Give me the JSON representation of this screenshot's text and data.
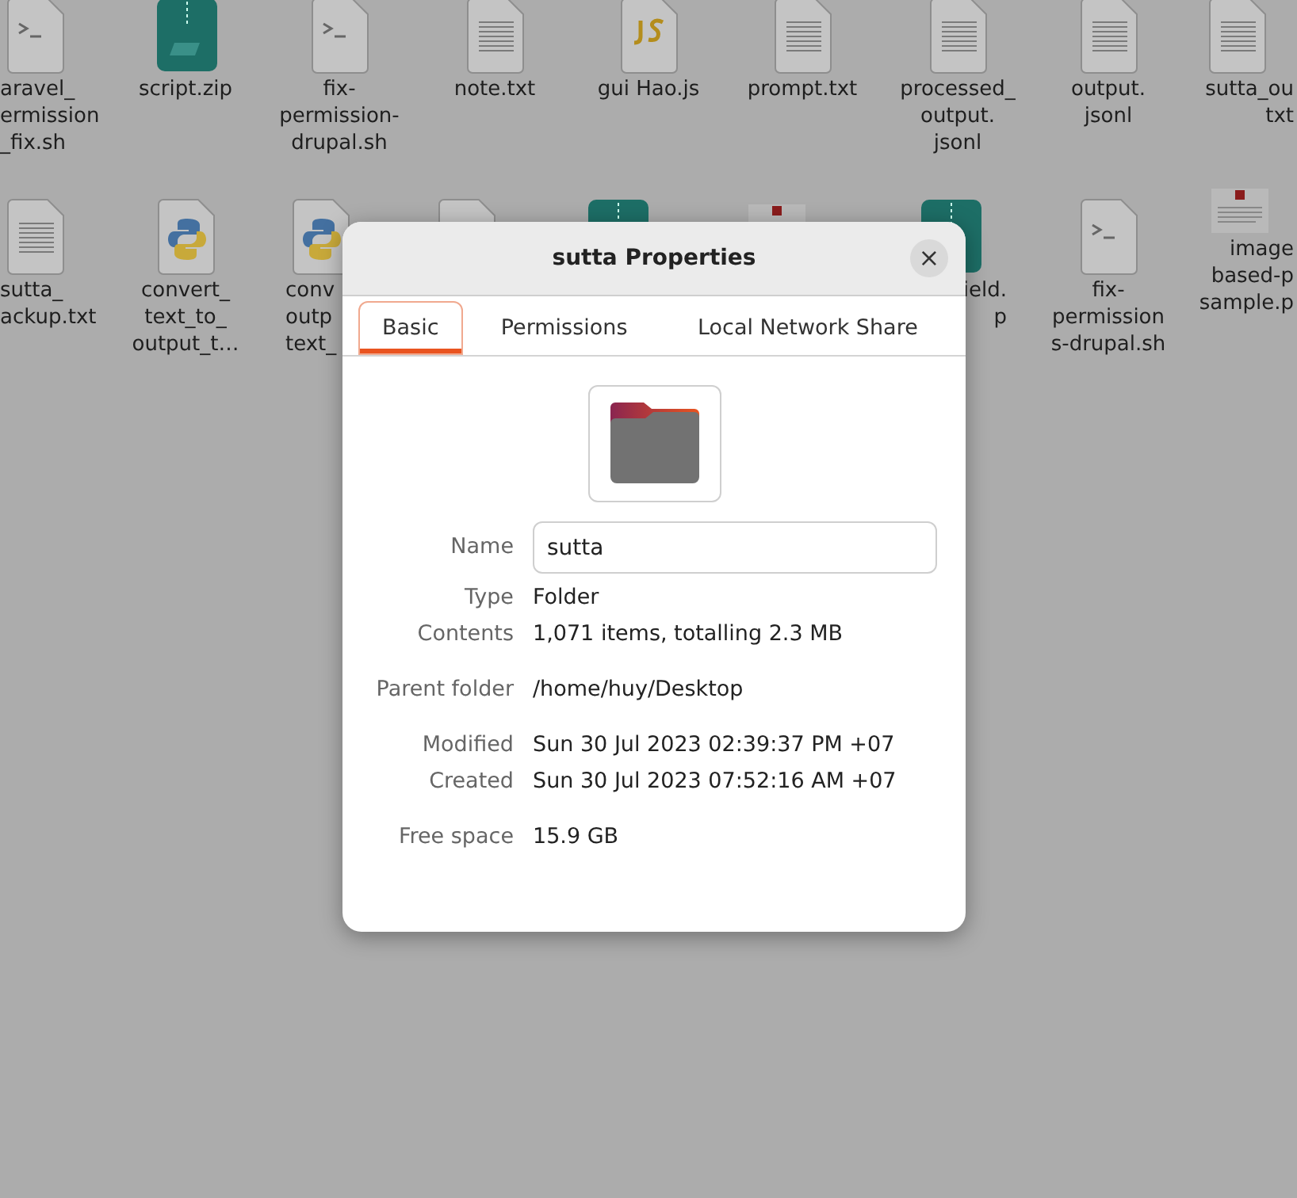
{
  "desktop_items": [
    {
      "kind": "script",
      "lines": [
        "aravel_",
        "ermission",
        "_fix.sh"
      ]
    },
    {
      "kind": "zip",
      "lines": [
        "script.zip"
      ]
    },
    {
      "kind": "script",
      "lines": [
        "fix-",
        "permission-",
        "drupal.sh"
      ]
    },
    {
      "kind": "text",
      "lines": [
        "note.txt"
      ]
    },
    {
      "kind": "js",
      "lines": [
        "gui Hao.js"
      ]
    },
    {
      "kind": "text",
      "lines": [
        "prompt.txt"
      ]
    },
    {
      "kind": "text",
      "lines": [
        "processed_",
        "output.",
        "jsonl"
      ]
    },
    {
      "kind": "text",
      "lines": [
        "output.",
        "jsonl"
      ]
    },
    {
      "kind": "text",
      "lines": [
        "sutta_ou",
        "txt"
      ]
    },
    {
      "kind": "text",
      "lines": [
        "sutta_",
        "ackup.txt"
      ]
    },
    {
      "kind": "python",
      "lines": [
        "convert_",
        "text_to_",
        "output_t…"
      ]
    },
    {
      "kind": "python",
      "lines": [
        "conv",
        "outp",
        "text_"
      ]
    },
    {
      "kind": "text"
    },
    {
      "kind": "zip"
    },
    {
      "kind": "thumb"
    },
    {
      "kind": "zip",
      "lines": [
        "ield.",
        "p"
      ]
    },
    {
      "kind": "script",
      "lines": [
        "fix-",
        "permission",
        "s-drupal.sh"
      ]
    },
    {
      "kind": "thumb",
      "lines": [
        "image",
        "based-p",
        "sample.p"
      ]
    }
  ],
  "dialog": {
    "title": "sutta Properties",
    "close": "×",
    "tabs": [
      {
        "label": "Basic",
        "selected": true
      },
      {
        "label": "Permissions",
        "selected": false
      },
      {
        "label": "Local Network Share",
        "selected": false
      }
    ],
    "name": {
      "label": "Name",
      "value": "sutta"
    },
    "groups": [
      [
        {
          "label": "Type",
          "value": "Folder"
        },
        {
          "label": "Contents",
          "value": "1,071 items, totalling 2.3 MB"
        }
      ],
      [
        {
          "label": "Parent folder",
          "value": "/home/huy/Desktop"
        }
      ],
      [
        {
          "label": "Modified",
          "value": "Sun 30 Jul 2023 02:39:37 PM +07"
        },
        {
          "label": "Created",
          "value": "Sun 30 Jul 2023 07:52:16 AM +07"
        }
      ],
      [
        {
          "label": "Free space",
          "value": "15.9 GB"
        }
      ]
    ]
  }
}
